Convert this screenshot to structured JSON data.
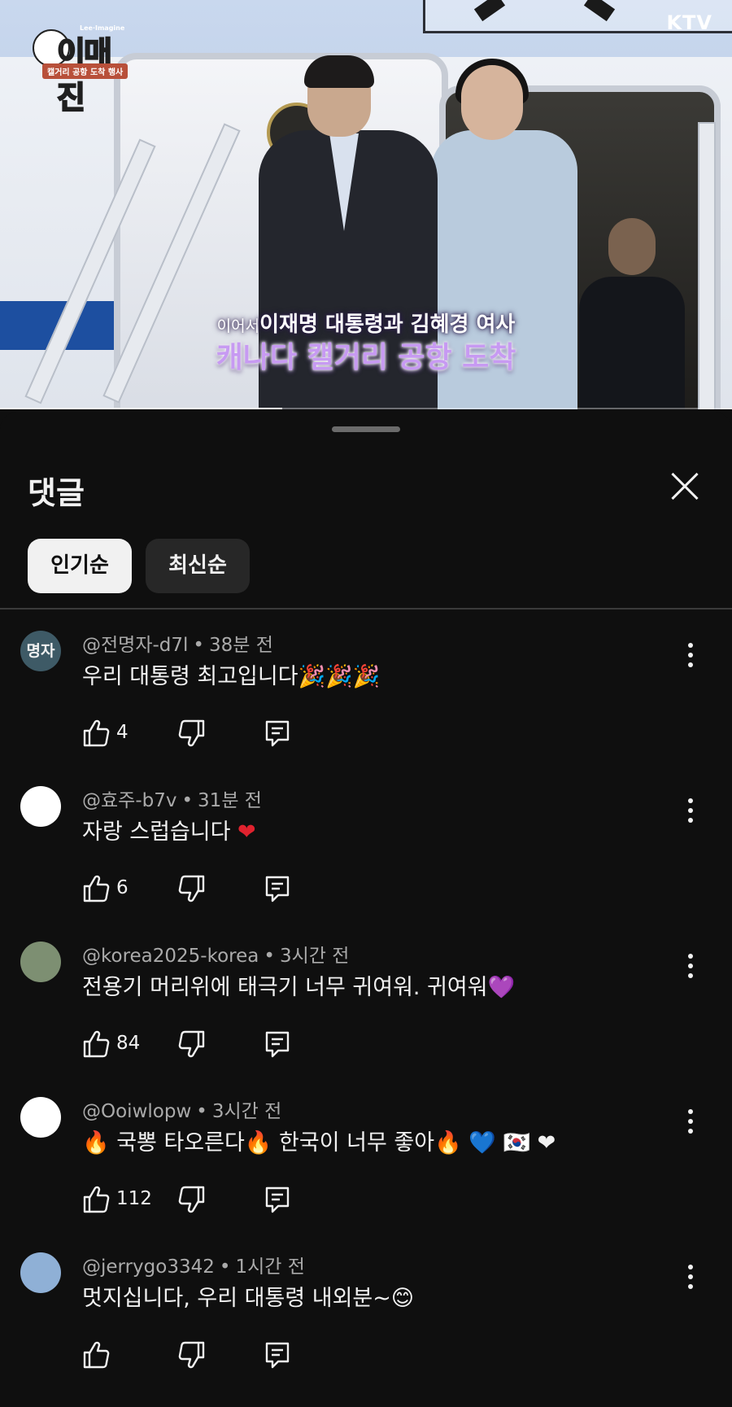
{
  "video": {
    "brand_title": "이매진",
    "brand_superscript": "Lee·Imagine",
    "brand_subtitle": "캘거리 공항 도착 행사",
    "channel_logo": "KTV",
    "caption_lead": "이어서",
    "caption_line1": "이재명 대통령과 김혜경 여사",
    "caption_line2": "캐나다 캘거리 공항 도착",
    "progress": 0.385
  },
  "sheet": {
    "title": "댓글",
    "close_icon": "close-icon",
    "sort_tabs": [
      {
        "label": "인기순",
        "active": true
      },
      {
        "label": "최신순",
        "active": false
      }
    ]
  },
  "comments": [
    {
      "author": "@전명자-d7l",
      "time": "38분 전",
      "avatar_text": "명자",
      "avatar_color": "#3e5a66",
      "text": "우리 대통령 최고입니다",
      "emoji": "🎉🎉🎉",
      "likes": "4"
    },
    {
      "author": "@효주-b7v",
      "time": "31분 전",
      "avatar_text": "",
      "avatar_color": "#ffffff",
      "text": "자랑 스럽습니다 ",
      "emoji": "❤",
      "likes": "6"
    },
    {
      "author": "@korea2025-korea",
      "time": "3시간 전",
      "avatar_text": "",
      "avatar_color": "#7d8f72",
      "text": "전용기 머리위에 태극기 너무 귀여워. 귀여워",
      "emoji": "💜",
      "likes": "84"
    },
    {
      "author": "@Ooiwlopw",
      "time": "3시간 전",
      "avatar_text": "",
      "avatar_color": "#ffffff",
      "text": "🔥 국뽕 타오른다🔥 한국이 너무 좋아🔥 💙 🇰🇷 ❤",
      "emoji": "",
      "likes": "112"
    },
    {
      "author": "@jerrygo3342",
      "time": "1시간 전",
      "avatar_text": "",
      "avatar_color": "#8fb0d6",
      "text": "멋지십니다,  우리  대통령 내외분~",
      "emoji": "😊",
      "likes": ""
    }
  ],
  "icons": {
    "like": "thumbs-up-icon",
    "dislike": "thumbs-down-icon",
    "reply": "reply-icon",
    "more": "more-vert-icon"
  },
  "colors": {
    "background": "#0f0f0f",
    "text_primary": "#f1f1f1",
    "text_secondary": "#aaaaaa",
    "chip_active": "#f1f1f1",
    "chip_inactive": "#272727",
    "caption_purple": "#c79af2"
  }
}
